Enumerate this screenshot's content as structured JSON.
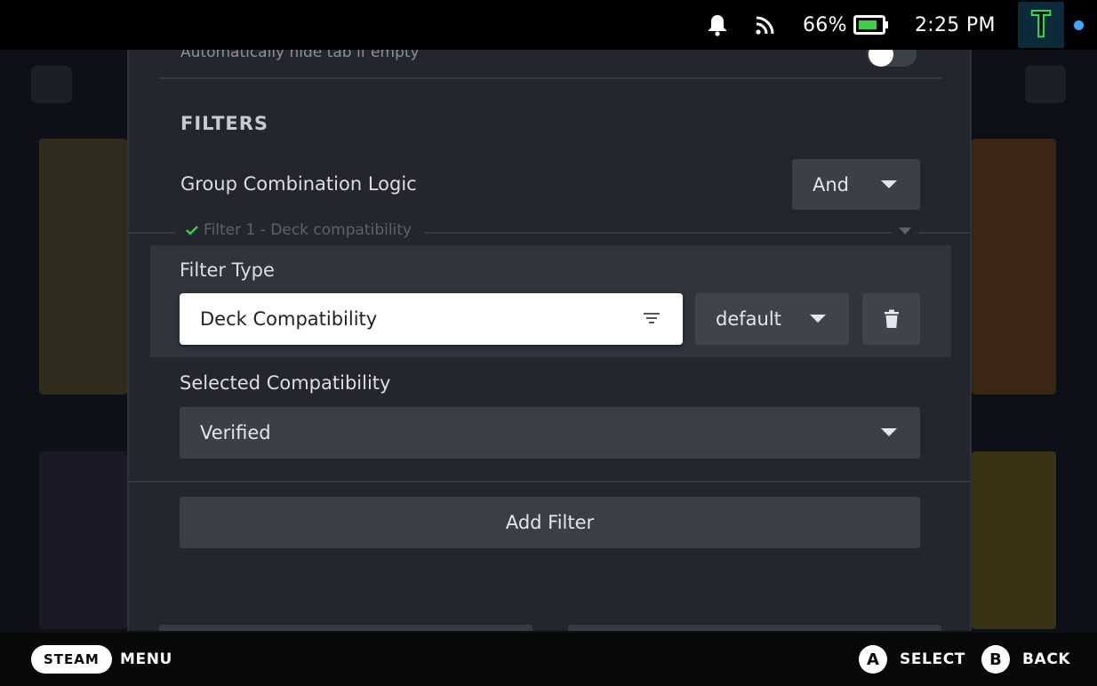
{
  "status_bar": {
    "battery_percent": "66%",
    "time": "2:25 PM",
    "avatar_letter": "T",
    "icons": [
      "bell-icon",
      "wifi-icon",
      "battery-icon"
    ]
  },
  "modal": {
    "auto_hide_label": "Automatically hide tab if empty",
    "filters_title": "FILTERS",
    "group_logic_label": "Group Combination Logic",
    "group_logic_value": "And",
    "filter1_legend": "Filter 1 - Deck compatibility",
    "filter_type_label": "Filter Type",
    "filter_type_value": "Deck Compatibility",
    "mode_value": "default",
    "selected_compat_label": "Selected Compatibility",
    "selected_compat_value": "Verified",
    "add_filter_label": "Add Filter"
  },
  "bottom_bar": {
    "steam_label": "STEAM",
    "menu_label": "MENU",
    "a_glyph": "A",
    "select_label": "SELECT",
    "b_glyph": "B",
    "back_label": "BACK"
  },
  "colors": {
    "accent_check": "#3ccf4a",
    "modal_bg": "#23262e",
    "panel_bg": "#30343c",
    "dropdown_bg": "#3b3f47"
  }
}
